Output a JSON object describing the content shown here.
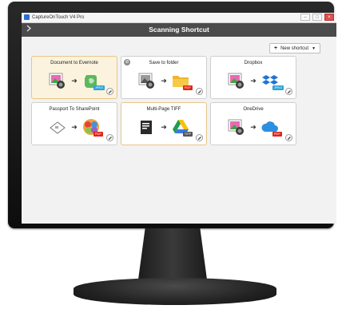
{
  "window": {
    "app_title": "CaptureOnTouch V4 Pro",
    "buttons": [
      "–",
      "□",
      "×"
    ]
  },
  "header": {
    "menu_icon": "chevron-right-icon",
    "title": "Scanning Shortcut"
  },
  "toolbar": {
    "new_shortcut_plus": "+",
    "new_shortcut_label": "New shortcut",
    "new_shortcut_caret": "▼"
  },
  "shortcuts": [
    {
      "title": "Document to Evernote",
      "source": "photo",
      "dest": "evernote",
      "badge": "JPEG",
      "badge_color": "#2aa3d6",
      "selected": true
    },
    {
      "title": "Save to folder",
      "source": "photo-bw",
      "dest": "folder",
      "badge": "PDF",
      "badge_color": "#e0251b",
      "selected": false,
      "deletable": true
    },
    {
      "title": "Dropbox",
      "source": "photo",
      "dest": "dropbox",
      "badge": "JPEG",
      "badge_color": "#2aa3d6",
      "selected": false
    },
    {
      "title": "Passport To SharePoint",
      "source": "passport",
      "dest": "sharepoint",
      "badge": "PDF",
      "badge_color": "#e0251b",
      "selected": false
    },
    {
      "title": "Multi-Page TIFF",
      "source": "document",
      "dest": "drive",
      "badge": "TIFF",
      "badge_color": "#555555",
      "selected": false,
      "highlight": true
    },
    {
      "title": "OneDrive",
      "source": "photo",
      "dest": "onedrive",
      "badge": "PDF",
      "badge_color": "#e0251b",
      "selected": false
    }
  ],
  "colors": {
    "header_bg": "#4b4b4b",
    "selected_card_bg": "#fbf3dd",
    "selected_card_border": "#e7c68a"
  }
}
